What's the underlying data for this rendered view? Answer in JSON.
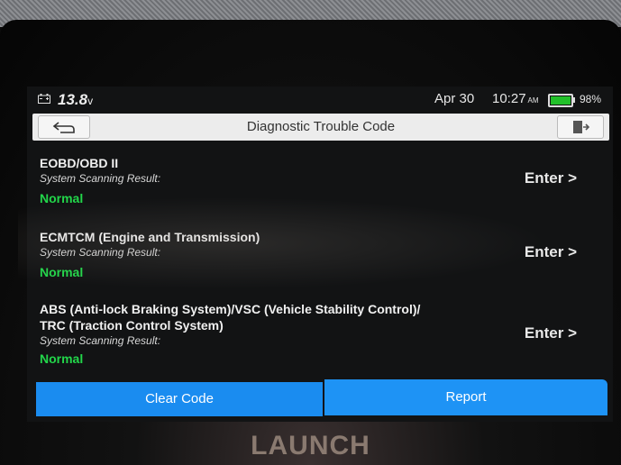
{
  "status_bar": {
    "voltage": "13.8",
    "voltage_unit": "v",
    "date": "Apr 30",
    "time": "10:27",
    "ampm": "AM",
    "battery_percent": "98%",
    "battery_level": 0.98
  },
  "header": {
    "title": "Diagnostic Trouble Code"
  },
  "systems": [
    {
      "name": "EOBD/OBD II",
      "result_label": "System Scanning Result:",
      "status": "Normal",
      "enter_label": "Enter >"
    },
    {
      "name": "ECMTCM (Engine and Transmission)",
      "result_label": "System Scanning Result:",
      "status": "Normal",
      "enter_label": "Enter >"
    },
    {
      "name_line1": "ABS (Anti-lock Braking System)/VSC (Vehicle Stability Control)/",
      "name_line2": "TRC (Traction Control System)",
      "result_label": "System Scanning Result:",
      "status": "Normal",
      "enter_label": "Enter >"
    }
  ],
  "buttons": {
    "clear_code": "Clear Code",
    "report": "Report"
  },
  "brand": "LAUNCH",
  "colors": {
    "accent_blue": "#1a8cf0",
    "status_green": "#22d64a",
    "header_bg": "#ececec"
  },
  "icons": {
    "car_battery": "car-battery-icon",
    "back": "back-arrow-icon",
    "exit": "exit-icon",
    "device_battery": "battery-icon"
  }
}
